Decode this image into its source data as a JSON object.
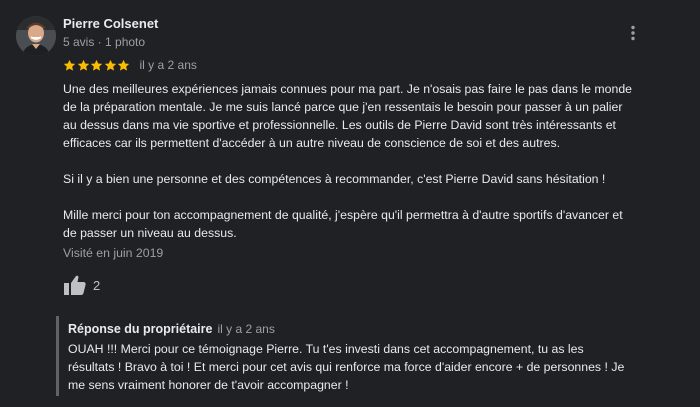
{
  "review": {
    "reviewer_name": "Pierre Colsenet",
    "reviewer_meta": "5 avis · 1 photo",
    "rating": 5,
    "rating_max": 5,
    "date": "il y a 2 ans",
    "paragraphs": [
      "Une des meilleures expériences jamais connues pour ma part. Je n'osais pas faire le pas dans le monde\nde la préparation mentale. Je me suis lancé parce que j'en ressentais le besoin pour passer à un palier\nau dessus dans ma vie sportive et professionnelle. Les outils de Pierre David sont très intéressants et\nefficaces car ils permettent d'accéder à un autre niveau de conscience de soi et des autres.",
      "Si il y a bien une personne et des compétences à recommander, c'est Pierre David sans hésitation !",
      "Mille merci pour ton accompagnement de qualité, j'espère qu'il permettra à d'autre sportifs d'avancer et\nde passer un niveau au dessus."
    ],
    "visit_date": "Visité en juin 2019",
    "like_count": "2",
    "icons": {
      "more": "more-vert-icon",
      "like": "thumb-up-icon",
      "star": "star-icon"
    }
  },
  "owner_response": {
    "title": "Réponse du propriétaire",
    "date": "il y a 2 ans",
    "text": "OUAH !!! Merci pour ce témoignage Pierre. Tu t'es investi dans cet accompagnement, tu as les\nrésultats ! Bravo à toi ! Et merci pour cet avis qui renforce ma force d'aider encore + de personnes ! Je\nme sens vraiment honorer de t'avoir accompagner !"
  },
  "colors": {
    "background": "#202124",
    "star": "#fbbc04",
    "text_primary": "#e8eaed",
    "text_secondary": "#9aa0a6",
    "response_border": "#5f6368"
  }
}
